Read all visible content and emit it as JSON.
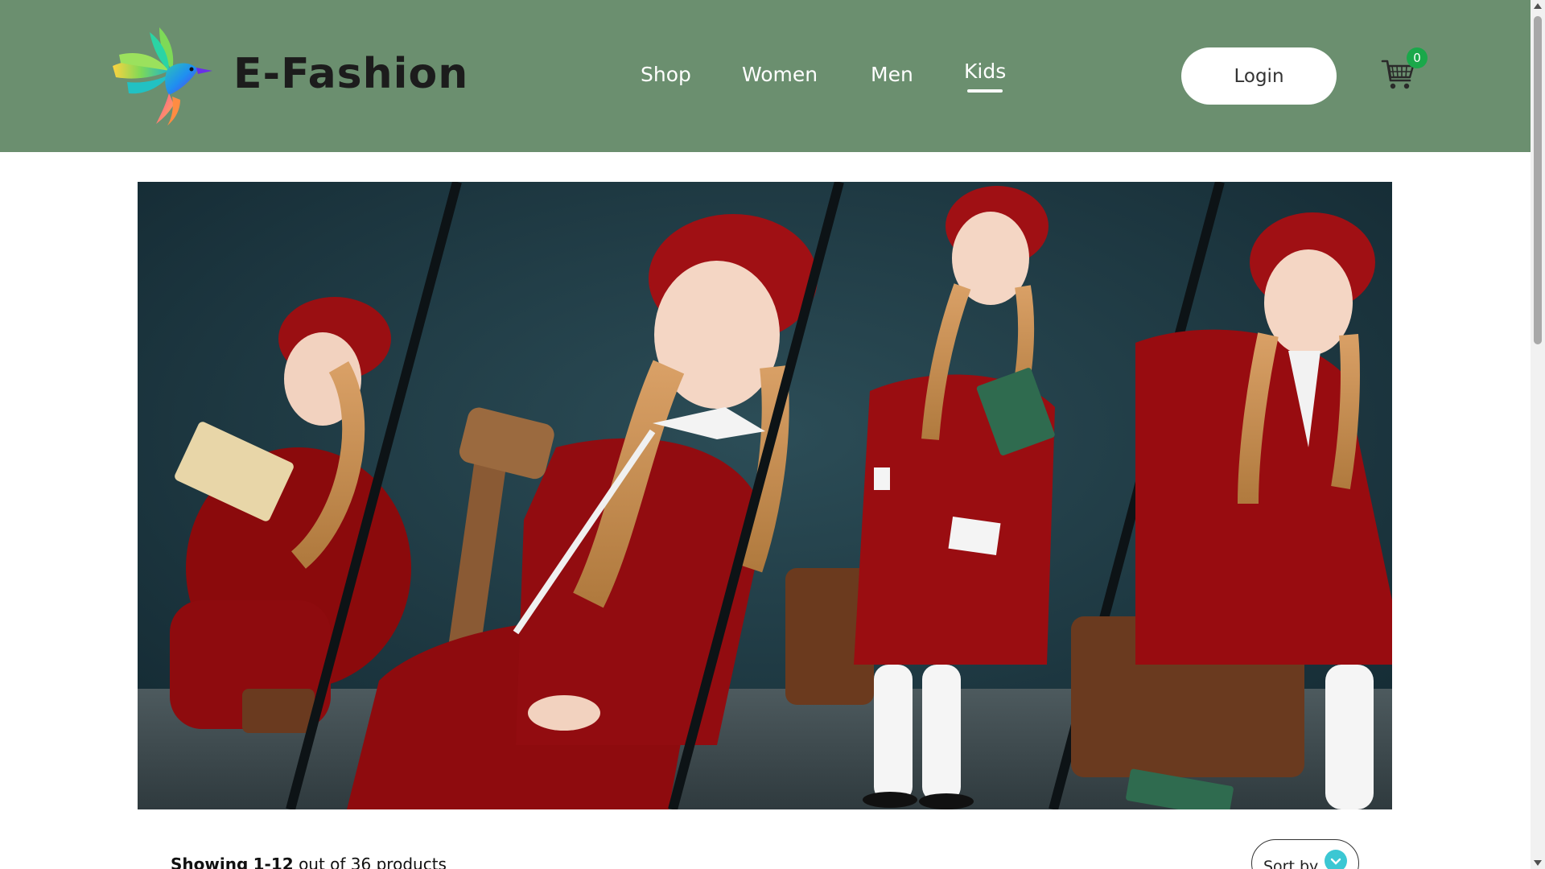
{
  "header": {
    "brand": "E-Fashion",
    "logo_icon": "hummingbird-logo-icon",
    "background": "#6b8f6f"
  },
  "nav": {
    "items": [
      {
        "label": "Shop",
        "active": false
      },
      {
        "label": "Women",
        "active": false
      },
      {
        "label": "Men",
        "active": false
      },
      {
        "label": "Kids",
        "active": true
      }
    ]
  },
  "account": {
    "login_label": "Login"
  },
  "cart": {
    "icon": "cart-icon",
    "count": "0",
    "badge_color": "#1aa84a"
  },
  "hero": {
    "image_icon": "kids-fashion-banner-image"
  },
  "listing": {
    "showing_prefix": "Showing",
    "range": "1-12",
    "suffix": "out of 36 products",
    "sort_label": "Sort by",
    "sort_icon": "chevron-down-icon"
  }
}
